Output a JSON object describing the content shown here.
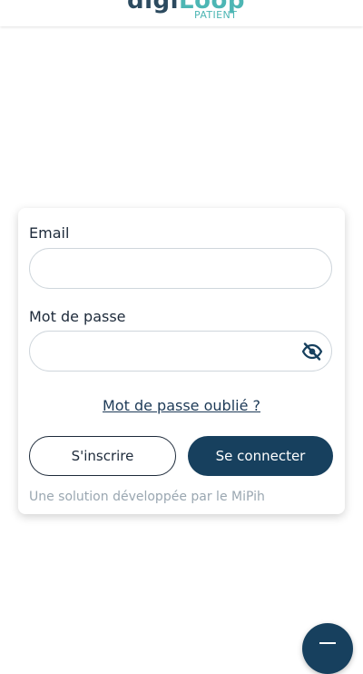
{
  "header": {
    "logo_part1": "digi",
    "logo_part2": "Loop",
    "logo_sub": "PATIENT"
  },
  "login": {
    "email_label": "Email",
    "email_value": "",
    "password_label": "Mot de passe",
    "password_value": "",
    "forgot_password": "Mot de passe oublié ?",
    "signup_button": "S'inscrire",
    "login_button": "Se connecter",
    "credit": "Une solution développée par le MiPih"
  },
  "colors": {
    "primary": "#17405e",
    "accent": "#4db6b4",
    "muted_text": "#9aa7b1"
  },
  "icons": {
    "password_toggle": "eye-off-icon",
    "fab": "menu-icon"
  }
}
